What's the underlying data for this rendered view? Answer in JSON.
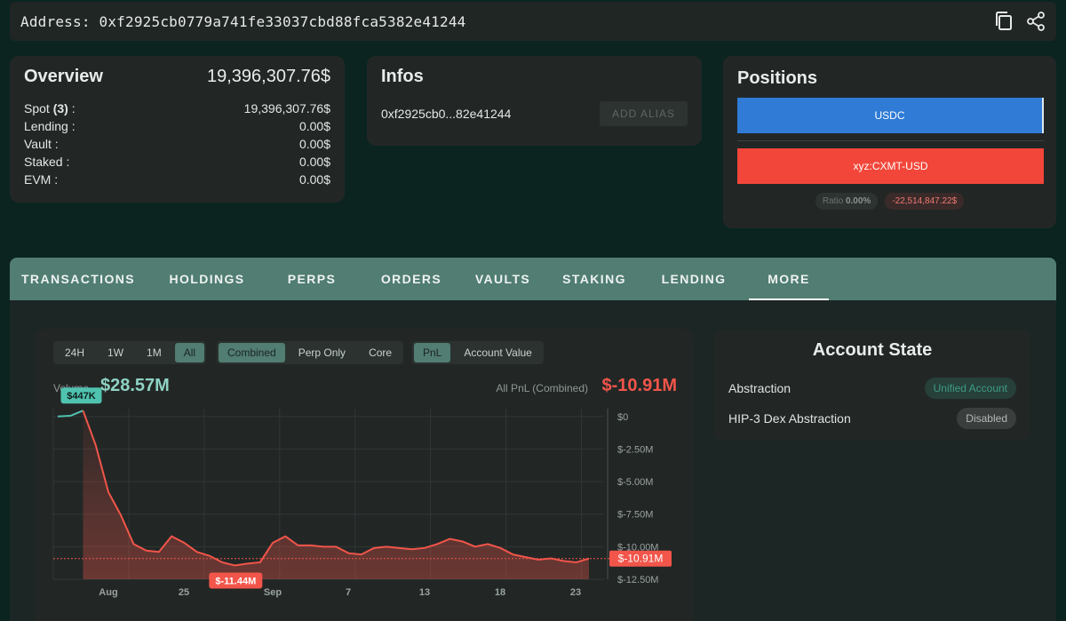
{
  "address_bar": {
    "label": "Address:",
    "address": "0xf2925cb0779a741fe33037cbd88fca5382e41244",
    "icons": [
      "copy-icon",
      "share-icon"
    ]
  },
  "overview": {
    "title": "Overview",
    "total": "19,396,307.76$",
    "rows": [
      {
        "label": "Spot",
        "count": "(3)",
        "suffix": " :",
        "value": "19,396,307.76$"
      },
      {
        "label": "Lending :",
        "value": "0.00$"
      },
      {
        "label": "Vault :",
        "value": "0.00$"
      },
      {
        "label": "Staked :",
        "value": "0.00$"
      },
      {
        "label": "EVM :",
        "value": "0.00$"
      }
    ]
  },
  "infos": {
    "title": "Infos",
    "short_address": "0xf2925cb0...82e41244",
    "add_alias_label": "ADD ALIAS"
  },
  "positions": {
    "title": "Positions",
    "long_label": "USDC",
    "short_label": "xyz:CXMT-USD",
    "ratio_label": "Ratio",
    "ratio_value": "0.00%",
    "net_value": "-22,514,847.22$",
    "colors": {
      "long": "#2f7bd6",
      "short": "#f2463a"
    }
  },
  "tabs": [
    {
      "label": "TRANSACTIONS",
      "active": false
    },
    {
      "label": "HOLDINGS",
      "active": false
    },
    {
      "label": "PERPS",
      "active": false
    },
    {
      "label": "ORDERS",
      "active": false
    },
    {
      "label": "VAULTS",
      "active": false
    },
    {
      "label": "STAKING",
      "active": false
    },
    {
      "label": "LENDING",
      "active": false
    },
    {
      "label": "MORE",
      "active": true
    }
  ],
  "chart_controls": {
    "ranges": [
      {
        "label": "24H",
        "on": false
      },
      {
        "label": "1W",
        "on": false
      },
      {
        "label": "1M",
        "on": false
      },
      {
        "label": "All",
        "on": true
      }
    ],
    "scope": [
      {
        "label": "Combined",
        "on": true
      },
      {
        "label": "Perp Only",
        "on": false
      },
      {
        "label": "Core",
        "on": false
      }
    ],
    "metric": [
      {
        "label": "PnL",
        "on": true
      },
      {
        "label": "Account Value",
        "on": false
      }
    ]
  },
  "stats": {
    "volume_label": "Volume",
    "volume_value": "$28.57M",
    "pnl_label": "All PnL (Combined)",
    "pnl_value": "$-10.91M"
  },
  "chart_data": {
    "type": "area",
    "title": "",
    "xlabel": "",
    "ylabel": "",
    "x_tick_labels": [
      "Aug",
      "25",
      "Sep",
      "7",
      "13",
      "18",
      "23"
    ],
    "y_tick_labels": [
      "$0",
      "$-2.50M",
      "$-5.00M",
      "$-7.50M",
      "$-10.00M",
      "$-12.50M"
    ],
    "ylim": [
      -12.5,
      0.6
    ],
    "y_unit": "M USD",
    "series": [
      {
        "values": [
          0.0,
          0.05,
          0.45,
          -2.2,
          -5.8,
          -7.6,
          -9.8,
          -10.3,
          -10.4,
          -9.2,
          -9.7,
          -10.4,
          -10.7,
          -11.2,
          -11.44,
          -11.3,
          -11.2,
          -9.7,
          -9.2,
          -9.9,
          -9.9,
          -10.0,
          -10.0,
          -10.5,
          -10.6,
          -10.1,
          -10.0,
          -10.1,
          -10.2,
          -10.1,
          -9.8,
          -9.4,
          -9.6,
          -10.0,
          -9.8,
          -10.1,
          -10.6,
          -10.8,
          -11.0,
          -10.9,
          -11.1,
          -11.2,
          -10.91
        ]
      }
    ],
    "labels": {
      "max": "$447K",
      "min": "$-11.44M",
      "last": "$-10.91M"
    },
    "grid": true,
    "colors": {
      "loss": "#f2554a",
      "gain": "#4fc3b0"
    }
  },
  "account_state": {
    "title": "Account State",
    "rows": [
      {
        "label": "Abstraction",
        "value": "Unified Account"
      },
      {
        "label": "HIP-3 Dex Abstraction",
        "value": "Disabled"
      }
    ]
  }
}
